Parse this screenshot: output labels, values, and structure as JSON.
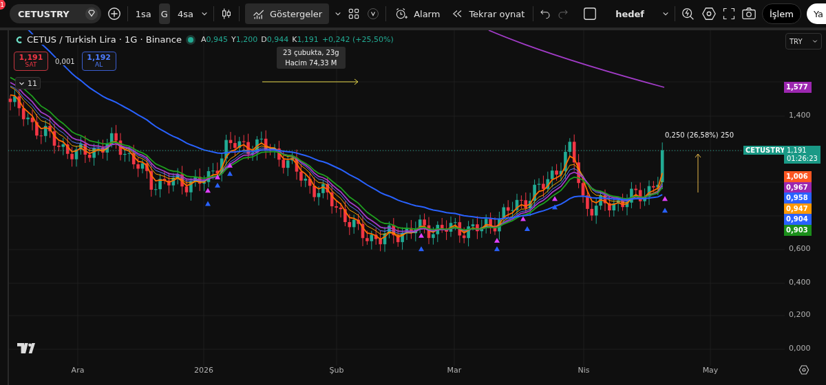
{
  "notification_badge": "1",
  "toolbar": {
    "symbol": "CETUSTRY",
    "intervals": [
      {
        "label": "1sa",
        "selected": false
      },
      {
        "label": "G",
        "selected": true
      },
      {
        "label": "4sa",
        "selected": false
      }
    ],
    "indicators": "Göstergeler",
    "alarm": "Alarm",
    "replay": "Tekrar oynat",
    "layout": "hedef",
    "trade": "İşlem",
    "cut_button": "Ya"
  },
  "legend": {
    "title": "CETUS / Turkish Lira · 1G · Binance",
    "ohlc": [
      {
        "key": "A",
        "value": "0,945"
      },
      {
        "key": "Y",
        "value": "1,200"
      },
      {
        "key": "D",
        "value": "0,944"
      },
      {
        "key": "K",
        "value": "1,191"
      }
    ],
    "change": "+0,242 (+25,50%)"
  },
  "order_buttons": {
    "sell": {
      "price": "1,191",
      "label": "SAT"
    },
    "spread": "0,001",
    "buy": {
      "price": "1,192",
      "label": "AL"
    }
  },
  "indicator_count": "11",
  "tooltip": [
    "23 çubukta, 23g",
    "Hacim 74,33 M"
  ],
  "measure_label": "0,250 (26,58%) 250",
  "currency": "TRY",
  "price_ticks": [
    "1,400",
    "0,600",
    "0,400",
    "0,200",
    "0,000"
  ],
  "last_price": {
    "symbol": "CETUSTRY",
    "price": "1,191",
    "countdown": "01:26:23"
  },
  "line_labels": [
    {
      "value": "1,577",
      "color": "#9c27b0"
    },
    {
      "value": "1,006",
      "color": "#ff5722"
    },
    {
      "value": "0,967",
      "color": "#9c27b0"
    },
    {
      "value": "0,958",
      "color": "#2962ff"
    },
    {
      "value": "0,947",
      "color": "#ff9800"
    },
    {
      "value": "0,904",
      "color": "#2962ff"
    },
    {
      "value": "0,903",
      "color": "#1b8f1b"
    }
  ],
  "time_labels": [
    "Ara",
    "2026",
    "Şub",
    "Mar",
    "Nis",
    "May"
  ]
}
